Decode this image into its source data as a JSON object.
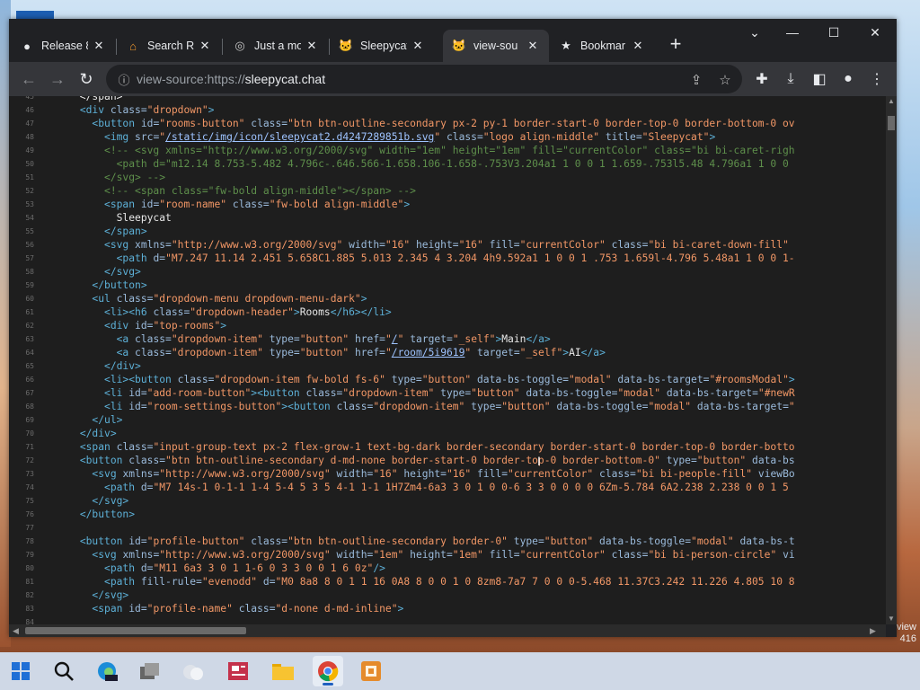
{
  "browser": {
    "tabs": [
      {
        "title": "Release 8",
        "icon": "github-icon",
        "active": false
      },
      {
        "title": "Search Re",
        "icon": "home-icon",
        "active": false
      },
      {
        "title": "Just a mo",
        "icon": "globe-icon",
        "active": false
      },
      {
        "title": "Sleepycat",
        "icon": "cat-icon",
        "active": false
      },
      {
        "title": "view-sou",
        "icon": "cat-icon",
        "active": true
      },
      {
        "title": "Bookmar",
        "icon": "star-icon",
        "active": false
      }
    ],
    "url_prefix": "view-source:https://",
    "url_host": "sleepycat.chat"
  },
  "source_lines": [
    {
      "n": "45",
      "html": "      &lt;/span&gt;"
    },
    {
      "n": "46",
      "html": "      <span class=\"t\">&lt;div</span> <span class=\"a\">class=</span><span class=\"v\">\"dropdown\"</span><span class=\"t\">&gt;</span>"
    },
    {
      "n": "47",
      "html": "        <span class=\"t\">&lt;button</span> <span class=\"a\">id=</span><span class=\"v\">\"rooms-button\"</span> <span class=\"a\">class=</span><span class=\"v\">\"btn btn-outline-secondary px-2 py-1 border-start-0 border-top-0 border-bottom-0 ov</span>"
    },
    {
      "n": "48",
      "html": "          <span class=\"t\">&lt;img</span> <span class=\"a\">src=</span><span class=\"v\">\"</span><span class=\"l\">/static/img/icon/sleepycat2.d4247289851b.svg</span><span class=\"v\">\"</span> <span class=\"a\">class=</span><span class=\"v\">\"logo align-middle\"</span> <span class=\"a\">title=</span><span class=\"v\">\"Sleepycat\"</span><span class=\"t\">&gt;</span>"
    },
    {
      "n": "49",
      "html": "          <span class=\"c\">&lt;!-- &lt;svg xmlns=\"http://www.w3.org/2000/svg\" width=\"1em\" height=\"1em\" fill=\"currentColor\" class=\"bi bi-caret-righ</span>"
    },
    {
      "n": "50",
      "html": "            <span class=\"c\">&lt;path d=\"m12.14 8.753-5.482 4.796c-.646.566-1.658.106-1.658-.753V3.204a1 1 0 0 1 1.659-.753l5.48 4.796a1 1 0 0</span>"
    },
    {
      "n": "51",
      "html": "          <span class=\"c\">&lt;/svg&gt; --&gt;</span>"
    },
    {
      "n": "52",
      "html": "          <span class=\"c\">&lt;!-- &lt;span class=\"fw-bold align-middle\"&gt;&lt;/span&gt; --&gt;</span>"
    },
    {
      "n": "53",
      "html": "          <span class=\"t\">&lt;span</span> <span class=\"a\">id=</span><span class=\"v\">\"room-name\"</span> <span class=\"a\">class=</span><span class=\"v\">\"fw-bold align-middle\"</span><span class=\"t\">&gt;</span>"
    },
    {
      "n": "54",
      "html": "            Sleepycat"
    },
    {
      "n": "55",
      "html": "          <span class=\"t\">&lt;/span&gt;</span>"
    },
    {
      "n": "56",
      "html": "          <span class=\"t\">&lt;svg</span> <span class=\"a\">xmlns=</span><span class=\"v\">\"http://www.w3.org/2000/svg\"</span> <span class=\"a\">width=</span><span class=\"v\">\"16\"</span> <span class=\"a\">height=</span><span class=\"v\">\"16\"</span> <span class=\"a\">fill=</span><span class=\"v\">\"currentColor\"</span> <span class=\"a\">class=</span><span class=\"v\">\"bi bi-caret-down-fill\"</span>"
    },
    {
      "n": "57",
      "html": "            <span class=\"t\">&lt;path</span> <span class=\"a\">d=</span><span class=\"v\">\"M7.247 11.14 2.451 5.658C1.885 5.013 2.345 4 3.204 4h9.592a1 1 0 0 1 .753 1.659l-4.796 5.48a1 1 0 0 1-</span>"
    },
    {
      "n": "58",
      "html": "          <span class=\"t\">&lt;/svg&gt;</span>"
    },
    {
      "n": "59",
      "html": "        <span class=\"t\">&lt;/button&gt;</span>"
    },
    {
      "n": "60",
      "html": "        <span class=\"t\">&lt;ul</span> <span class=\"a\">class=</span><span class=\"v\">\"dropdown-menu dropdown-menu-dark\"</span><span class=\"t\">&gt;</span>"
    },
    {
      "n": "61",
      "html": "          <span class=\"t\">&lt;li&gt;&lt;h6</span> <span class=\"a\">class=</span><span class=\"v\">\"dropdown-header\"</span><span class=\"t\">&gt;</span>Rooms<span class=\"t\">&lt;/h6&gt;&lt;/li&gt;</span>"
    },
    {
      "n": "62",
      "html": "          <span class=\"t\">&lt;div</span> <span class=\"a\">id=</span><span class=\"v\">\"top-rooms\"</span><span class=\"t\">&gt;</span>"
    },
    {
      "n": "63",
      "html": "            <span class=\"t\">&lt;a</span> <span class=\"a\">class=</span><span class=\"v\">\"dropdown-item\"</span> <span class=\"a\">type=</span><span class=\"v\">\"button\"</span> <span class=\"a\">href=</span><span class=\"v\">\"</span><span class=\"l\">/</span><span class=\"v\">\"</span> <span class=\"a\">target=</span><span class=\"v\">\"_self\"</span><span class=\"t\">&gt;</span>Main<span class=\"t\">&lt;/a&gt;</span>"
    },
    {
      "n": "64",
      "html": "            <span class=\"t\">&lt;a</span> <span class=\"a\">class=</span><span class=\"v\">\"dropdown-item\"</span> <span class=\"a\">type=</span><span class=\"v\">\"button\"</span> <span class=\"a\">href=</span><span class=\"v\">\"</span><span class=\"l\">/room/5i9619</span><span class=\"v\">\"</span> <span class=\"a\">target=</span><span class=\"v\">\"_self\"</span><span class=\"t\">&gt;</span>AI<span class=\"t\">&lt;/a&gt;</span>"
    },
    {
      "n": "65",
      "html": "          <span class=\"t\">&lt;/div&gt;</span>"
    },
    {
      "n": "66",
      "html": "          <span class=\"t\">&lt;li&gt;&lt;button</span> <span class=\"a\">class=</span><span class=\"v\">\"dropdown-item fw-bold fs-6\"</span> <span class=\"a\">type=</span><span class=\"v\">\"button\"</span> <span class=\"a\">data-bs-toggle=</span><span class=\"v\">\"modal\"</span> <span class=\"a\">data-bs-target=</span><span class=\"v\">\"#roomsModal\"</span><span class=\"t\">&gt;</span>"
    },
    {
      "n": "67",
      "html": "          <span class=\"t\">&lt;li</span> <span class=\"a\">id=</span><span class=\"v\">\"add-room-button\"</span><span class=\"t\">&gt;&lt;button</span> <span class=\"a\">class=</span><span class=\"v\">\"dropdown-item\"</span> <span class=\"a\">type=</span><span class=\"v\">\"button\"</span> <span class=\"a\">data-bs-toggle=</span><span class=\"v\">\"modal\"</span> <span class=\"a\">data-bs-target=</span><span class=\"v\">\"#newR</span>"
    },
    {
      "n": "68",
      "html": "          <span class=\"t\">&lt;li</span> <span class=\"a\">id=</span><span class=\"v\">\"room-settings-button\"</span><span class=\"t\">&gt;&lt;button</span> <span class=\"a\">class=</span><span class=\"v\">\"dropdown-item\"</span> <span class=\"a\">type=</span><span class=\"v\">\"button\"</span> <span class=\"a\">data-bs-toggle=</span><span class=\"v\">\"modal\"</span> <span class=\"a\">data-bs-target=</span><span class=\"v\">\"</span>"
    },
    {
      "n": "69",
      "html": "        <span class=\"t\">&lt;/ul&gt;</span>"
    },
    {
      "n": "70",
      "html": "      <span class=\"t\">&lt;/div&gt;</span>"
    },
    {
      "n": "71",
      "html": "      <span class=\"t\">&lt;span</span> <span class=\"a\">class=</span><span class=\"v\">\"input-group-text px-2 flex-grow-1 text-bg-dark border-secondary border-start-0 border-top-0 border-botto</span>"
    },
    {
      "n": "72",
      "html": "      <span class=\"t\">&lt;button</span> <span class=\"a\">class=</span><span class=\"v\">\"btn btn-outline-secondary d-md-none border-start-0 border-top-0 border-bottom-0\"</span> <span class=\"a\">type=</span><span class=\"v\">\"button\"</span> <span class=\"a\">data-bs</span>"
    },
    {
      "n": "73",
      "html": "        <span class=\"t\">&lt;svg</span> <span class=\"a\">xmlns=</span><span class=\"v\">\"http://www.w3.org/2000/svg\"</span> <span class=\"a\">width=</span><span class=\"v\">\"16\"</span> <span class=\"a\">height=</span><span class=\"v\">\"16\"</span> <span class=\"a\">fill=</span><span class=\"v\">\"currentColor\"</span> <span class=\"a\">class=</span><span class=\"v\">\"bi bi-people-fill\"</span> <span class=\"a\">viewBo</span>"
    },
    {
      "n": "74",
      "html": "          <span class=\"t\">&lt;path</span> <span class=\"a\">d=</span><span class=\"v\">\"M7 14s-1 0-1-1 1-4 5-4 5 3 5 4-1 1-1 1H7Zm4-6a3 3 0 1 0 0-6 3 3 0 0 0 0 6Zm-5.784 6A2.238 2.238 0 0 1 5</span>"
    },
    {
      "n": "75",
      "html": "        <span class=\"t\">&lt;/svg&gt;</span>"
    },
    {
      "n": "76",
      "html": "      <span class=\"t\">&lt;/button&gt;</span>"
    },
    {
      "n": "77",
      "html": ""
    },
    {
      "n": "78",
      "html": "      <span class=\"t\">&lt;button</span> <span class=\"a\">id=</span><span class=\"v\">\"profile-button\"</span> <span class=\"a\">class=</span><span class=\"v\">\"btn btn-outline-secondary border-0\"</span> <span class=\"a\">type=</span><span class=\"v\">\"button\"</span> <span class=\"a\">data-bs-toggle=</span><span class=\"v\">\"modal\"</span> <span class=\"a\">data-bs-t</span>"
    },
    {
      "n": "79",
      "html": "        <span class=\"t\">&lt;svg</span> <span class=\"a\">xmlns=</span><span class=\"v\">\"http://www.w3.org/2000/svg\"</span> <span class=\"a\">width=</span><span class=\"v\">\"1em\"</span> <span class=\"a\">height=</span><span class=\"v\">\"1em\"</span> <span class=\"a\">fill=</span><span class=\"v\">\"currentColor\"</span> <span class=\"a\">class=</span><span class=\"v\">\"bi bi-person-circle\"</span> <span class=\"a\">vi</span>"
    },
    {
      "n": "80",
      "html": "          <span class=\"t\">&lt;path</span> <span class=\"a\">d=</span><span class=\"v\">\"M11 6a3 3 0 1 1-6 0 3 3 0 0 1 6 0z\"</span><span class=\"t\">/&gt;</span>"
    },
    {
      "n": "81",
      "html": "          <span class=\"t\">&lt;path</span> <span class=\"a\">fill-rule=</span><span class=\"v\">\"evenodd\"</span> <span class=\"a\">d=</span><span class=\"v\">\"M0 8a8 8 0 1 1 16 0A8 8 0 0 1 0 8zm8-7a7 7 0 0 0-5.468 11.37C3.242 11.226 4.805 10 8</span>"
    },
    {
      "n": "82",
      "html": "        <span class=\"t\">&lt;/svg&gt;</span>"
    },
    {
      "n": "83",
      "html": "        <span class=\"t\">&lt;span</span> <span class=\"a\">id=</span><span class=\"v\">\"profile-name\"</span> <span class=\"a\">class=</span><span class=\"v\">\"d-none d-md-inline\"</span><span class=\"t\">&gt;</span>"
    },
    {
      "n": "84",
      "html": ""
    }
  ],
  "desktop": {
    "corner_text_1": "view",
    "corner_text_2": "416"
  },
  "taskbar": {
    "items": [
      "windows-start-icon",
      "search-icon",
      "edge-beta-icon",
      "task-view-icon",
      "weather-icon",
      "news-icon",
      "file-explorer-icon",
      "chrome-icon",
      "app-icon"
    ]
  }
}
